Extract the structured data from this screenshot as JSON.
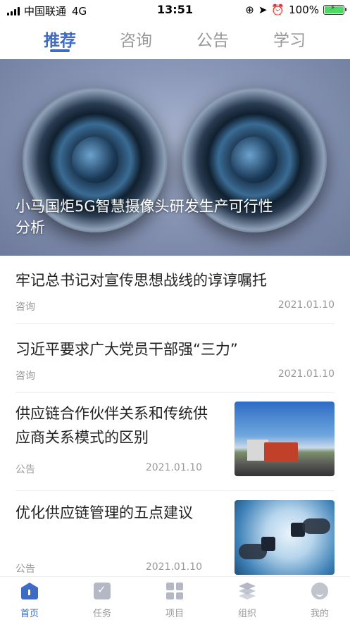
{
  "status_bar": {
    "carrier": "中国联通",
    "network": "4G",
    "time": "13:51",
    "battery": "100%"
  },
  "tabs": [
    {
      "label": "推荐",
      "active": true
    },
    {
      "label": "咨询",
      "active": false
    },
    {
      "label": "公告",
      "active": false
    },
    {
      "label": "学习",
      "active": false
    }
  ],
  "hero": {
    "title": "小马国炬5G智慧摄像头研发生产可行性分析"
  },
  "news": [
    {
      "title": "牢记总书记对宣传思想战线的谆谆嘱托",
      "category": "咨询",
      "date": "2021.01.10"
    },
    {
      "title": "习近平要求广大党员干部强“三力”",
      "category": "咨询",
      "date": "2021.01.10"
    },
    {
      "title": "供应链合作伙伴关系和传统供应商关系模式的区别",
      "category": "公告",
      "date": "2021.01.10",
      "thumbnail": "truck-road-photo"
    },
    {
      "title": "优化供应链管理的五点建议",
      "category": "公告",
      "date": "2021.01.10",
      "thumbnail": "puzzle-hands-photo"
    }
  ],
  "bottom_nav": [
    {
      "label": "首页",
      "icon": "home-icon",
      "active": true
    },
    {
      "label": "任务",
      "icon": "task-icon",
      "active": false
    },
    {
      "label": "项目",
      "icon": "grid-icon",
      "active": false
    },
    {
      "label": "组织",
      "icon": "layers-icon",
      "active": false
    },
    {
      "label": "我的",
      "icon": "profile-icon",
      "active": false
    }
  ],
  "colors": {
    "accent": "#3d6bc6",
    "inactive": "#999999"
  }
}
